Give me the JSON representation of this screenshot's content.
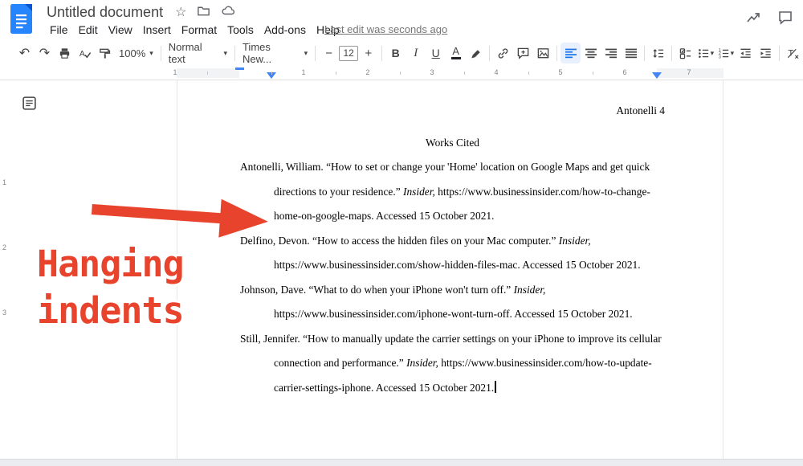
{
  "app": {
    "name": "Google Docs",
    "title": "Untitled document",
    "menus": [
      "File",
      "Edit",
      "View",
      "Insert",
      "Format",
      "Tools",
      "Add-ons",
      "Help"
    ],
    "last_edit": "Last edit was seconds ago"
  },
  "toolbar": {
    "zoom": "100%",
    "style": "Normal text",
    "font": "Times New...",
    "font_size": "12",
    "accent_color": "#1a73e8",
    "active_alignment": "left"
  },
  "icons": {
    "undo": "↶",
    "redo": "↷",
    "caret": "▾",
    "star": "☆",
    "minus": "−",
    "plus": "+",
    "bold": "B",
    "italic": "I",
    "underline": "U",
    "text_color": "A"
  },
  "ruler": {
    "h_numbers": [
      "1",
      "1",
      "2",
      "3",
      "4",
      "5",
      "6",
      "7"
    ],
    "v_numbers": [
      "1",
      "2",
      "3"
    ]
  },
  "document": {
    "page_header": "Antonelli 4",
    "title": "Works Cited",
    "citations": [
      {
        "segments": [
          {
            "text": "Antonelli, William. “How to set or change your 'Home' location on Google Maps and get quick directions to your residence.” ",
            "italic": false
          },
          {
            "text": "Insider,",
            "italic": true
          },
          {
            "text": " https://www.businessinsider.com/how-to-change-home-on-google-maps. Accessed 15 October 2021.",
            "italic": false
          }
        ]
      },
      {
        "segments": [
          {
            "text": "Delfino, Devon. “How to access the hidden files on your Mac computer.” ",
            "italic": false
          },
          {
            "text": "Insider,",
            "italic": true
          },
          {
            "text": " https://www.businessinsider.com/show-hidden-files-mac. Accessed 15 October 2021.",
            "italic": false
          }
        ]
      },
      {
        "segments": [
          {
            "text": "Johnson, Dave. “What to do when your iPhone won't turn off.” ",
            "italic": false
          },
          {
            "text": "Insider,",
            "italic": true
          },
          {
            "text": " https://www.businessinsider.com/iphone-wont-turn-off. Accessed 15 October 2021.",
            "italic": false
          }
        ]
      },
      {
        "segments": [
          {
            "text": "Still, Jennifer. “How to manually update the carrier settings on your iPhone to improve its cellular connection and performance.” ",
            "italic": false
          },
          {
            "text": "Insider,",
            "italic": true
          },
          {
            "text": " https://www.businessinsider.com/how-to-update-carrier-settings-iphone. Accessed 15 October 2021.",
            "italic": false
          }
        ]
      }
    ]
  },
  "annotation": {
    "line1": "Hanging",
    "line2": "indents",
    "color": "#e8432c"
  }
}
